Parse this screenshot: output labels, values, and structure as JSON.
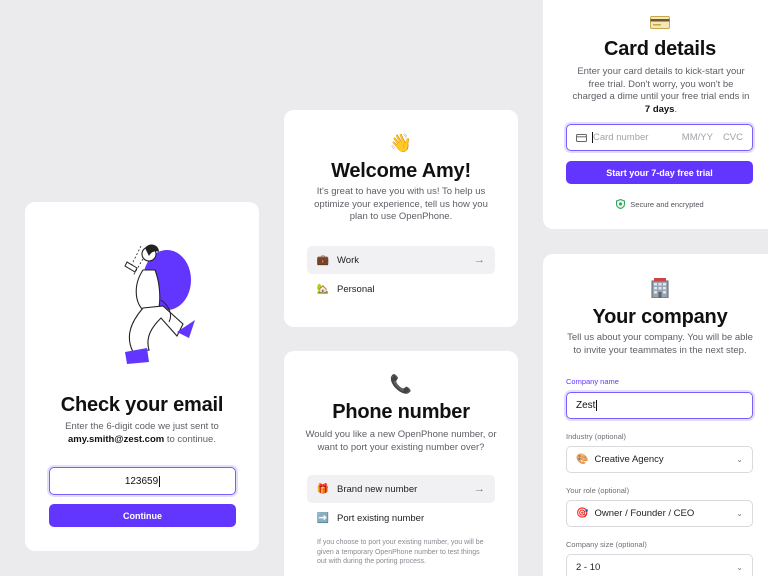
{
  "email_card": {
    "title": "Check your email",
    "subtitle_pre": "Enter the 6-digit code we just sent to",
    "email": "amy.smith@zest.com",
    "subtitle_post": " to continue.",
    "code_value": "123659",
    "continue_label": "Continue"
  },
  "welcome_card": {
    "icon": "👋",
    "title": "Welcome Amy!",
    "subtitle": "It's great to have you with us! To help us optimize your experience, tell us how you plan to use OpenPhone.",
    "options": [
      {
        "icon": "💼",
        "label": "Work",
        "arrow": "→"
      },
      {
        "icon": "🏡",
        "label": "Personal"
      }
    ]
  },
  "phone_card": {
    "icon": "📞",
    "title": "Phone number",
    "subtitle": "Would you like a new OpenPhone number, or want to port your existing number over?",
    "options": [
      {
        "icon": "🎁",
        "label": "Brand new number",
        "arrow": "→"
      },
      {
        "icon": "➡️",
        "label": "Port existing number"
      }
    ],
    "footnote": "If you choose to port your existing number, you will be given a temporary OpenPhone number to test things out with during the porting process."
  },
  "card_details": {
    "title": "Card details",
    "subtitle_pre": "Enter your card details to kick-start your free trial. Don't worry, you won't be charged a dime until your free trial ends in ",
    "subtitle_bold": "7 days",
    "subtitle_post": ".",
    "card_placeholder": "Card number",
    "expiry_placeholder": "MM/YY",
    "cvc_placeholder": "CVC",
    "trial_button": "Start your 7-day free trial",
    "secure_text": "Secure and encrypted"
  },
  "company_card": {
    "icon": "🏢",
    "title": "Your company",
    "subtitle": "Tell us about your company. You will be able to invite your teammates in the next step.",
    "company_name_label": "Company name",
    "company_name_value": "Zest",
    "industry_label": "Industry (optional)",
    "industry_icon": "🎨",
    "industry_value": "Creative Agency",
    "role_label": "Your role (optional)",
    "role_icon": "🎯",
    "role_value": "Owner / Founder / CEO",
    "size_label": "Company size (optional)",
    "size_value": "2 - 10"
  },
  "colors": {
    "accent": "#6236ff",
    "background": "#ebebed",
    "card": "#ffffff",
    "secure": "#2fa35a"
  }
}
